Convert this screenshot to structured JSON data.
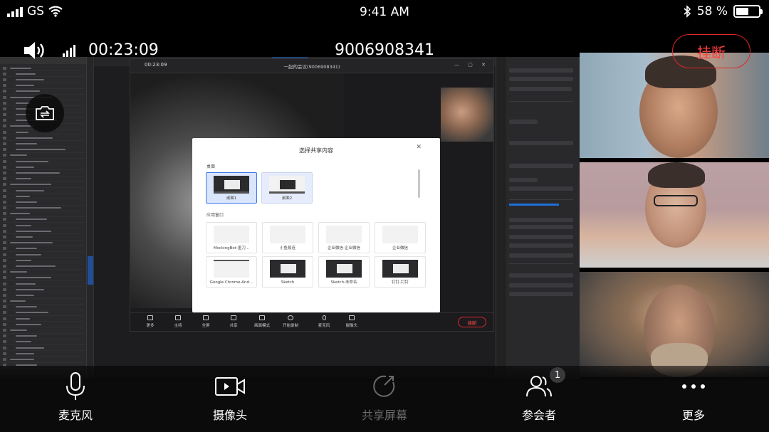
{
  "status_bar": {
    "carrier": "GS",
    "time": "9:41 AM",
    "battery": "58 %",
    "battery_level": 0.58
  },
  "call": {
    "duration": "00:23:09",
    "meeting_number": "9006908341",
    "hangup_label": "挂断"
  },
  "shared_window": {
    "time": "00:23:09",
    "title": "一起的会议(9006908341)",
    "toolbar": [
      "更多",
      "主持",
      "全屏",
      "共享",
      "画面模式",
      "开始录制",
      "麦克风",
      "摄像头"
    ],
    "end_label": "挂断"
  },
  "share_dialog": {
    "title": "选择共享内容",
    "desktop_section": "桌面",
    "desktops": [
      "桌面1",
      "桌面2"
    ],
    "apps_section": "应用窗口",
    "apps": [
      "MockingBot-墨刀...",
      "小鱼易连",
      "企业微信-企业微信",
      "企业微信",
      "Google Chrome-And...",
      "Sketch",
      "Sketch-未命名",
      "钉钉-钉钉"
    ]
  },
  "bottom_bar": {
    "mic": "麦克风",
    "camera": "摄像头",
    "share_screen": "共享屏幕",
    "participants": "参会者",
    "participants_count": "1",
    "more": "更多"
  },
  "icons": {
    "signal": "signal-bars-icon",
    "wifi": "wifi-icon",
    "bluetooth": "bluetooth-icon",
    "speaker": "speaker-icon",
    "network": "network-strength-icon",
    "camera_switch": "camera-switch-icon",
    "mic": "microphone-icon",
    "video": "video-camera-icon",
    "share": "share-screen-icon",
    "participants": "participants-icon",
    "more": "more-dots-icon"
  },
  "colors": {
    "hangup_red": "#e0262e",
    "selection_blue": "#3b78e7",
    "disabled_gray": "#6a6a6a"
  }
}
